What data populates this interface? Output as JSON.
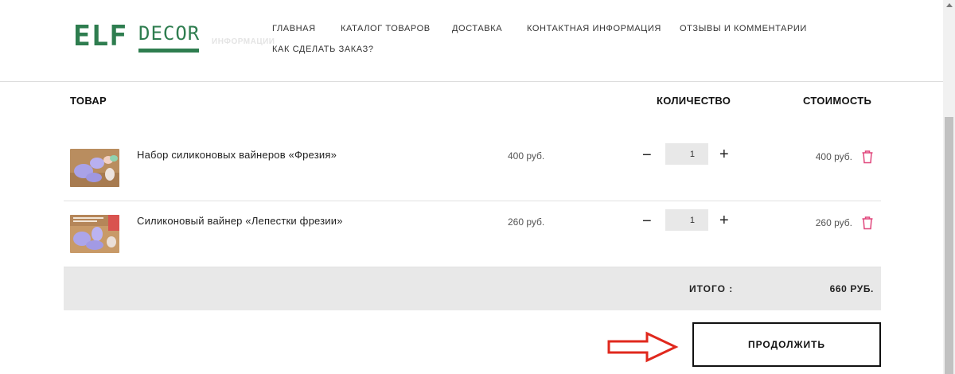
{
  "logo": {
    "part1": "ELF",
    "part2": "DECOR",
    "ghost_text": "ИНФОРМАЦИИ"
  },
  "nav": {
    "items": [
      "ГЛАВНАЯ",
      "КАТАЛОГ ТОВАРОВ",
      "ДОСТАВКА",
      "КОНТАКТНАЯ ИНФОРМАЦИЯ",
      "ОТЗЫВЫ И КОММЕНТАРИИ",
      "КАК СДЕЛАТЬ ЗАКАЗ?"
    ]
  },
  "cart": {
    "headers": {
      "product": "ТОВАР",
      "quantity": "КОЛИЧЕСТВО",
      "cost": "СТОИМОСТЬ"
    },
    "items": [
      {
        "name": "Набор силиконовых вайнеров «Фрезия»",
        "price": "400 руб.",
        "qty_minus": "−",
        "qty": "1",
        "qty_plus": "+",
        "sum": "400 руб."
      },
      {
        "name": "Силиконовый вайнер «Лепестки фрезии»",
        "price": "260 руб.",
        "qty_minus": "−",
        "qty": "1",
        "qty_plus": "+",
        "sum": "260 руб."
      }
    ],
    "total_label": "ИТОГО :",
    "total_value": "660 РУБ.",
    "continue_label": "ПРОДОЛЖИТЬ"
  },
  "colors": {
    "brand": "#2e7d4f",
    "delete": "#e0457b",
    "arrow": "#e0281d",
    "total_bg": "#e8e8e8"
  },
  "icons": {
    "delete": "trash-icon",
    "annotation": "arrow-right-icon"
  }
}
